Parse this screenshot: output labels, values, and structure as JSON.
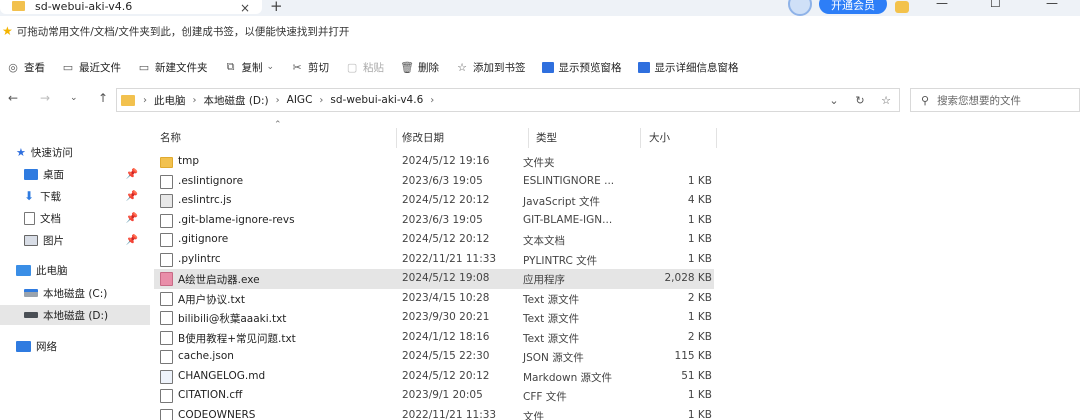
{
  "window": {
    "tab_title": "sd-webui-aki-v4.6",
    "tab_close": "×",
    "new_tab": "+",
    "vip_button": "开通会员",
    "minimize": "—",
    "maximize": "☐",
    "close": "—"
  },
  "bookmarks_hint": "可拖动常用文件/文档/文件夹到此，创建成书签，以便能快速找到并打开",
  "toolbar": {
    "view": "查看",
    "recent": "最近文件",
    "new_folder": "新建文件夹",
    "copy": "复制",
    "cut": "剪切",
    "paste": "粘贴",
    "delete": "删除",
    "add_bookmark": "添加到书签",
    "preview_pane": "显示预览窗格",
    "details_pane": "显示详细信息窗格"
  },
  "address": {
    "crumbs": [
      "此电脑",
      "本地磁盘 (D:)",
      "AIGC",
      "sd-webui-aki-v4.6"
    ],
    "search_placeholder": "搜索您想要的文件"
  },
  "sidebar": {
    "items": [
      {
        "label": "快速访问"
      },
      {
        "label": "桌面"
      },
      {
        "label": "下载"
      },
      {
        "label": "文档"
      },
      {
        "label": "图片"
      },
      {
        "label": "此电脑"
      },
      {
        "label": "本地磁盘 (C:)"
      },
      {
        "label": "本地磁盘 (D:)"
      },
      {
        "label": "网络"
      }
    ]
  },
  "columns": {
    "name": "名称",
    "date": "修改日期",
    "type": "类型",
    "size": "大小"
  },
  "files": [
    {
      "name": "tmp",
      "date": "2024/5/12 19:16",
      "type": "文件夹",
      "size": "",
      "icon": "folder-icon"
    },
    {
      "name": ".eslintignore",
      "date": "2023/6/3 19:05",
      "type": "ESLINTIGNORE ...",
      "size": "1 KB",
      "icon": "file-icon"
    },
    {
      "name": ".eslintrc.js",
      "date": "2024/5/12 20:12",
      "type": "JavaScript 文件",
      "size": "4 KB",
      "icon": "js-file-icon"
    },
    {
      "name": ".git-blame-ignore-revs",
      "date": "2023/6/3 19:05",
      "type": "GIT-BLAME-IGN...",
      "size": "1 KB",
      "icon": "file-icon"
    },
    {
      "name": ".gitignore",
      "date": "2024/5/12 20:12",
      "type": "文本文档",
      "size": "1 KB",
      "icon": "text-file-icon"
    },
    {
      "name": ".pylintrc",
      "date": "2022/11/21 11:33",
      "type": "PYLINTRC 文件",
      "size": "1 KB",
      "icon": "file-icon"
    },
    {
      "name": "A绘世启动器.exe",
      "date": "2024/5/12 19:08",
      "type": "应用程序",
      "size": "2,028 KB",
      "icon": "exe-icon"
    },
    {
      "name": "A用户协议.txt",
      "date": "2023/4/15 10:28",
      "type": "Text 源文件",
      "size": "2 KB",
      "icon": "text-file-icon"
    },
    {
      "name": "bilibili@秋葉aaaki.txt",
      "date": "2023/9/30 20:21",
      "type": "Text 源文件",
      "size": "1 KB",
      "icon": "text-file-icon"
    },
    {
      "name": "B使用教程+常见问题.txt",
      "date": "2024/1/12 18:16",
      "type": "Text 源文件",
      "size": "2 KB",
      "icon": "text-file-icon"
    },
    {
      "name": "cache.json",
      "date": "2024/5/15 22:30",
      "type": "JSON 源文件",
      "size": "115 KB",
      "icon": "json-file-icon"
    },
    {
      "name": "CHANGELOG.md",
      "date": "2024/5/12 20:12",
      "type": "Markdown 源文件",
      "size": "51 KB",
      "icon": "markdown-file-icon"
    },
    {
      "name": "CITATION.cff",
      "date": "2023/9/1 20:05",
      "type": "CFF 文件",
      "size": "1 KB",
      "icon": "file-icon"
    },
    {
      "name": "CODEOWNERS",
      "date": "2022/11/21 11:33",
      "type": "文件",
      "size": "1 KB",
      "icon": "file-icon"
    }
  ]
}
